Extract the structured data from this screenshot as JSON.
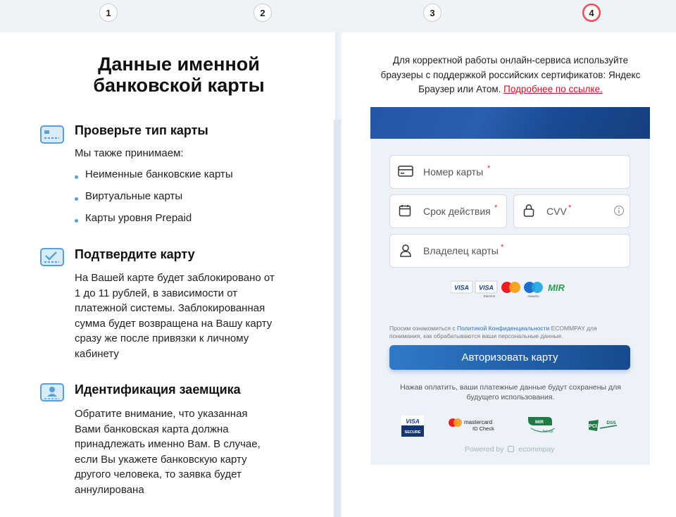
{
  "stepper": {
    "steps": [
      "1",
      "2",
      "3",
      "4"
    ],
    "active_step": "4"
  },
  "left": {
    "title_line1": "Данные именной",
    "title_line2": "банковской карты",
    "section1": {
      "title": "Проверьте тип карты",
      "intro": "Мы также принимаем:",
      "bullets": [
        "Неименные банковские карты",
        "Виртуальные карты",
        "Карты уровня Prepaid"
      ]
    },
    "section2": {
      "title": "Подтвердите карту",
      "lines": [
        "На Вашей карте будет заблокировано от",
        "1 до 11 рублей, в зависимости от",
        "платежной системы. Заблокированная",
        "сумма будет возвращена на Вашу карту",
        "сразу же после привязки к личному",
        "кабинету"
      ]
    },
    "section3": {
      "title": "Идентификация заемщика",
      "lines": [
        "Обратите внимание, что указанная",
        "Вами банковская карта должна",
        "принадлежать именно Вам. В случае,",
        "если Вы укажете банковскую карту",
        "другого человека, то заявка будет",
        "аннулирована"
      ]
    }
  },
  "notice": {
    "line1": "Для корректной работы онлайн-сервиса используйте",
    "line2": "браузеры с поддержкой российских сертификатов: Яндекс",
    "line3_prefix": "Браузер или Атом. ",
    "link": "Подробнее по ссылке."
  },
  "form": {
    "card_number": "Номер карты",
    "expiry": "Срок действия",
    "cvv": "CVV",
    "holder": "Владелец карты",
    "required_mark": "*",
    "brands": {
      "visa": "VISA",
      "visa_electron": "VISA",
      "electron_sub": "Electron",
      "maestro_sub": "maestro",
      "mir": "MIR"
    },
    "consent_prefix": "Просим ознакомиться с ",
    "consent_link": "Политикой Конфиденциальности",
    "consent_suffix": " ECOMMPAY для",
    "consent_line2": "понимания, как обрабатываются ваши персональные данные.",
    "submit": "Авторизовать карту",
    "save_note_line1": "Нажав оплатить, ваши платежные данные будут сохранены для",
    "save_note_line2": "будущего использования.",
    "trust": {
      "visa_secure_top": "VISA",
      "visa_secure_bottom": "SECURE",
      "mc_line1": "mastercard",
      "mc_line2": "ID Check",
      "mir_accept": "MIR",
      "mir_accept_sub": "Accept",
      "pci_left": "PCI",
      "pci_right": "DSS"
    },
    "powered_by": "Powered by",
    "powered_brand": "ecommpay"
  },
  "colors": {
    "accent": "#2f7ac9",
    "required": "#e0263b",
    "link_red": "#d0101e",
    "header_blue": "#1a4a93"
  }
}
